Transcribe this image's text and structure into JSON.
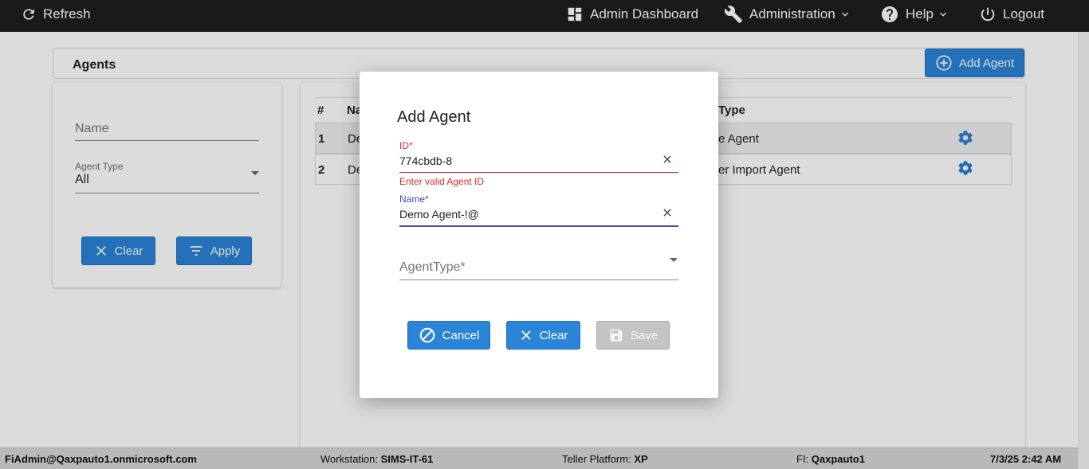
{
  "topbar": {
    "refresh_label": "Refresh",
    "dashboard_label": "Admin Dashboard",
    "administration_label": "Administration",
    "help_label": "Help",
    "logout_label": "Logout"
  },
  "page": {
    "title": "Agents",
    "add_agent_label": "Add Agent"
  },
  "filters": {
    "name_placeholder": "Name",
    "agent_type_label": "Agent Type",
    "agent_type_value": "All",
    "clear_label": "Clear",
    "apply_label": "Apply"
  },
  "table": {
    "col_num": "#",
    "col_name": "Na",
    "col_type": "Type",
    "rows": [
      {
        "num": "1",
        "name": "De",
        "type": "e Agent"
      },
      {
        "num": "2",
        "name": "De",
        "type": "er Import Agent"
      }
    ]
  },
  "modal": {
    "title": "Add Agent",
    "id_label": "ID*",
    "id_value": "774cbdb-8",
    "id_error": "Enter valid Agent ID",
    "name_label": "Name*",
    "name_value": "Demo Agent-!@",
    "agent_type_placeholder": "AgentType*",
    "cancel_label": "Cancel",
    "clear_label": "Clear",
    "save_label": "Save"
  },
  "footer": {
    "user": "FiAdmin@Qaxpauto1.onmicrosoft.com",
    "workstation_label": "Workstation:",
    "workstation_value": "SIMS-IT-61",
    "platform_label": "Teller Platform:",
    "platform_value": "XP",
    "fi_label": "FI:",
    "fi_value": "Qaxpauto1",
    "datetime": "7/3/25 2:42 AM"
  },
  "colors": {
    "topbar": "#1f1f1f",
    "primary": "#2a84d8",
    "error": "#d32f2f",
    "focus": "#3f51b5",
    "disabled": "#c4c4c4"
  }
}
